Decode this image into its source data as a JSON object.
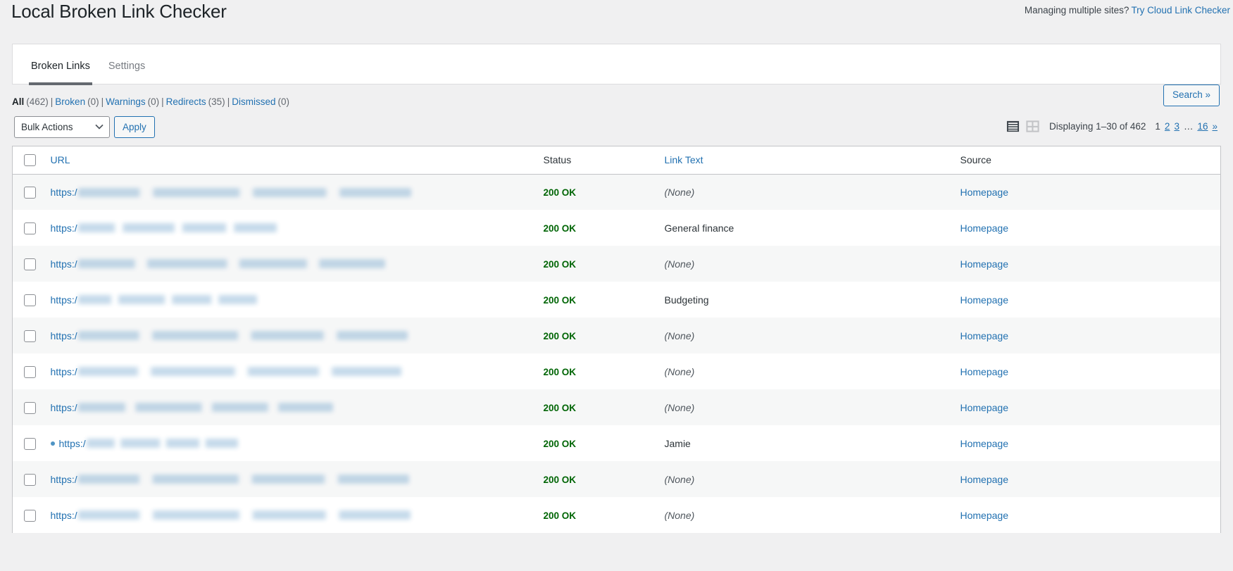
{
  "header": {
    "title": "Local Broken Link Checker",
    "managing_text": "Managing multiple sites?",
    "cloud_link_label": "Try Cloud Link Checker"
  },
  "tabs": [
    {
      "label": "Broken Links",
      "active": true
    },
    {
      "label": "Settings",
      "active": false
    }
  ],
  "filters": {
    "items": [
      {
        "label": "All",
        "count": "(462)",
        "current": true
      },
      {
        "label": "Broken",
        "count": "(0)",
        "current": false
      },
      {
        "label": "Warnings",
        "count": "(0)",
        "current": false
      },
      {
        "label": "Redirects",
        "count": "(35)",
        "current": false
      },
      {
        "label": "Dismissed",
        "count": "(0)",
        "current": false
      }
    ],
    "separator": "|"
  },
  "search_button_label": "Search »",
  "tablenav": {
    "bulk_actions_selected": "Bulk Actions",
    "bulk_actions_options": [
      "Bulk Actions"
    ],
    "apply_label": "Apply",
    "view_list_icon": "list-view-icon",
    "view_excerpt_icon": "excerpt-view-icon",
    "displaying_num": "Displaying 1–30 of 462",
    "pages": [
      {
        "label": "1",
        "current": true
      },
      {
        "label": "2",
        "current": false
      },
      {
        "label": "3",
        "current": false
      },
      {
        "label": "…",
        "dots": true
      },
      {
        "label": "16",
        "current": false
      },
      {
        "label": "»",
        "current": false
      }
    ]
  },
  "table": {
    "columns": [
      {
        "key": "cb",
        "label": "",
        "sortable": false
      },
      {
        "key": "url",
        "label": "URL",
        "sortable": true
      },
      {
        "key": "status",
        "label": "Status",
        "sortable": false
      },
      {
        "key": "link_text",
        "label": "Link Text",
        "sortable": true
      },
      {
        "key": "source",
        "label": "Source",
        "sortable": false
      }
    ],
    "rows": [
      {
        "url_scheme": "https:/",
        "url_redacted_width": 473,
        "new": false,
        "status": "200 OK",
        "link_text": "(None)",
        "link_text_none": true,
        "source": "Homepage"
      },
      {
        "url_scheme": "https:/",
        "url_redacted_width": 282,
        "new": false,
        "status": "200 OK",
        "link_text": "General finance",
        "link_text_none": false,
        "source": "Homepage"
      },
      {
        "url_scheme": "https:/",
        "url_redacted_width": 436,
        "new": false,
        "status": "200 OK",
        "link_text": "(None)",
        "link_text_none": true,
        "source": "Homepage"
      },
      {
        "url_scheme": "https:/",
        "url_redacted_width": 254,
        "new": false,
        "status": "200 OK",
        "link_text": "Budgeting",
        "link_text_none": false,
        "source": "Homepage"
      },
      {
        "url_scheme": "https:/",
        "url_redacted_width": 468,
        "new": false,
        "status": "200 OK",
        "link_text": "(None)",
        "link_text_none": true,
        "source": "Homepage"
      },
      {
        "url_scheme": "https:/",
        "url_redacted_width": 459,
        "new": false,
        "status": "200 OK",
        "link_text": "(None)",
        "link_text_none": true,
        "source": "Homepage"
      },
      {
        "url_scheme": "https:/",
        "url_redacted_width": 362,
        "new": false,
        "status": "200 OK",
        "link_text": "(None)",
        "link_text_none": true,
        "source": "Homepage"
      },
      {
        "url_scheme": "https:/",
        "url_redacted_width": 215,
        "new": true,
        "status": "200 OK",
        "link_text": "Jamie",
        "link_text_none": false,
        "source": "Homepage"
      },
      {
        "url_scheme": "https:/",
        "url_redacted_width": 470,
        "new": false,
        "status": "200 OK",
        "link_text": "(None)",
        "link_text_none": true,
        "source": "Homepage"
      },
      {
        "url_scheme": "https:/",
        "url_redacted_width": 472,
        "new": false,
        "status": "200 OK",
        "link_text": "(None)",
        "link_text_none": true,
        "source": "Homepage"
      }
    ]
  },
  "colors": {
    "accent_link": "#2271b1",
    "status_ok": "#006505",
    "page_bg": "#f0f0f1",
    "row_alt_bg": "#f6f7f7",
    "tab_underline": "#646970"
  }
}
